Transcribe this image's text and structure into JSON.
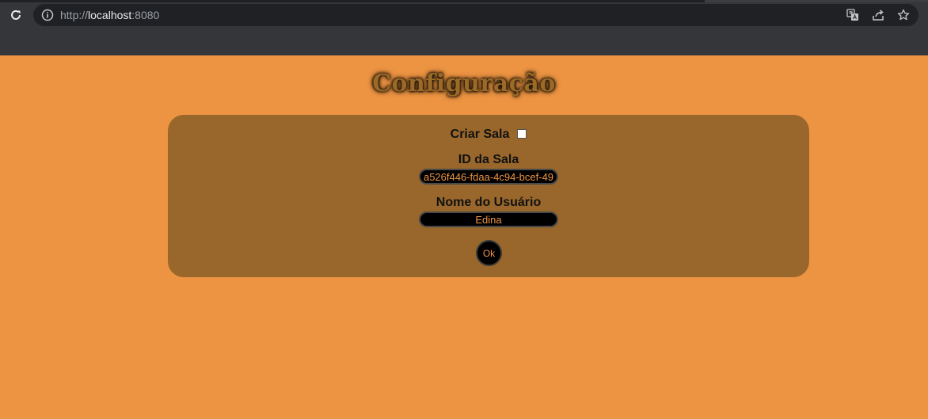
{
  "browser": {
    "url_scheme": "http://",
    "url_host": "localhost",
    "url_port": ":8080"
  },
  "page": {
    "title": "Configuração",
    "criar_sala_label": "Criar Sala",
    "criar_sala_checked": false,
    "id_sala_label": "ID da Sala",
    "id_sala_value": "a526f446-fdaa-4c94-bcef-49",
    "nome_usuario_label": "Nome do Usuário",
    "nome_usuario_value": "Edina",
    "ok_label": "Ok"
  },
  "colors": {
    "page_background": "#ed9443",
    "panel_background": "#99672b",
    "input_background": "#000000",
    "input_text": "#ed9443"
  }
}
